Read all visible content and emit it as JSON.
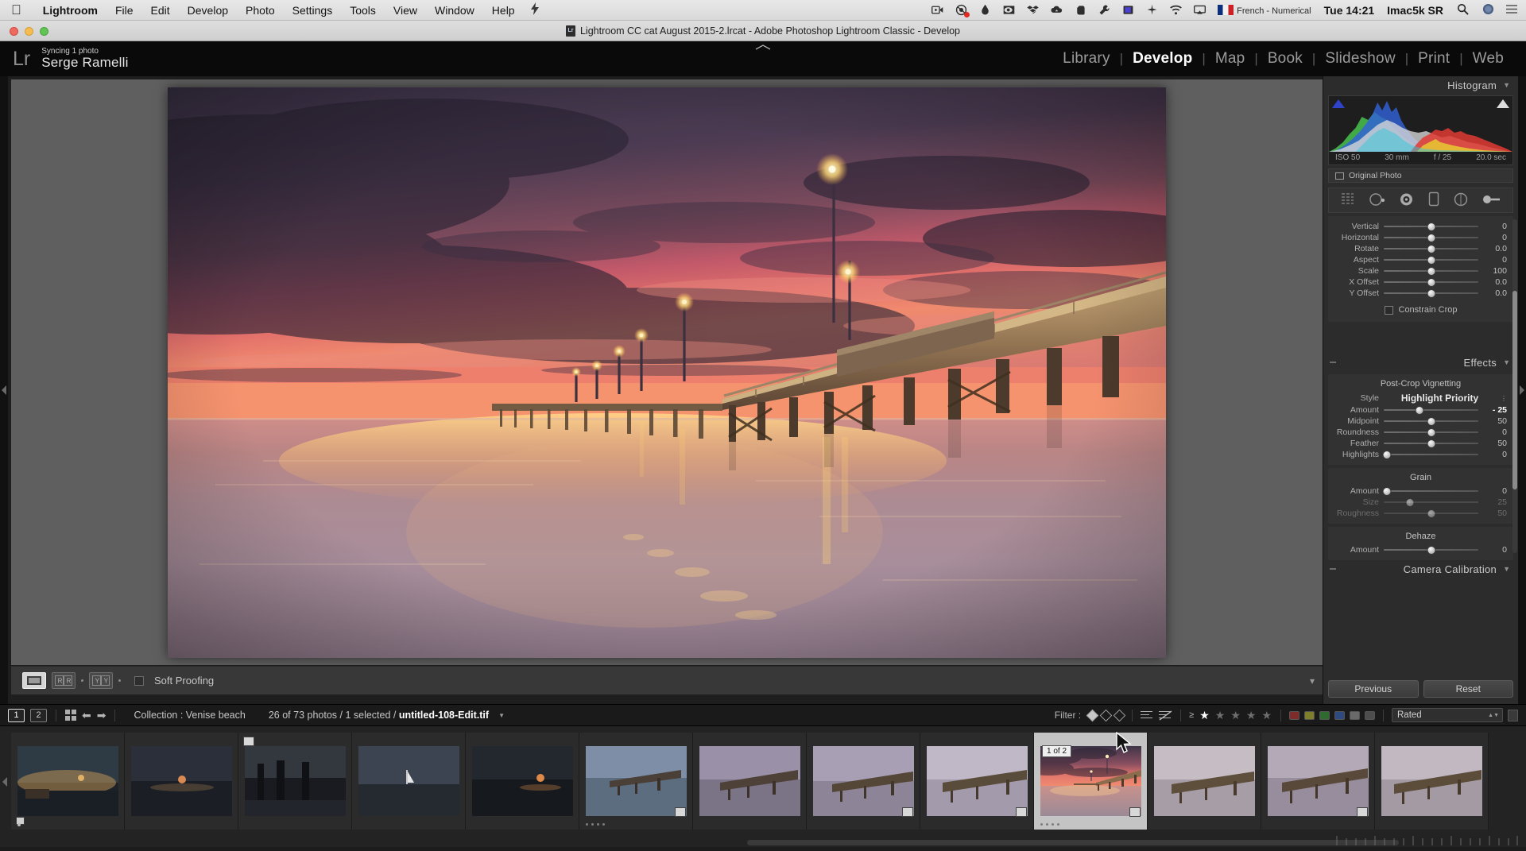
{
  "macmenu": {
    "apple_icon": "apple-logo-icon",
    "items": [
      {
        "label": "Lightroom",
        "bold": true
      },
      {
        "label": "File",
        "bold": false
      },
      {
        "label": "Edit",
        "bold": false
      },
      {
        "label": "Develop",
        "bold": false
      },
      {
        "label": "Photo",
        "bold": false
      },
      {
        "label": "Settings",
        "bold": false
      },
      {
        "label": "Tools",
        "bold": false
      },
      {
        "label": "View",
        "bold": false
      },
      {
        "label": "Window",
        "bold": false
      },
      {
        "label": "Help",
        "bold": false
      }
    ],
    "status_icons": [
      "screen-recording-icon",
      "camera-icon",
      "droplet-icon",
      "eye-icon",
      "dropbox-icon",
      "cloud-icon",
      "evernote-icon",
      "wrench-icon",
      "display-icon",
      "compass-icon",
      "wifi-icon",
      "airplay-icon"
    ],
    "language": "French - Numerical",
    "clock": "Tue 14:21",
    "user": "Imac5k SR",
    "search_icon": "search-icon",
    "siri_icon": "siri-icon",
    "control_center_icon": "control-center-icon"
  },
  "window": {
    "title": "Lightroom CC cat August 2015-2.lrcat - Adobe Photoshop Lightroom Classic - Develop",
    "doc_icon": "lightroom-catalog-icon",
    "close_label": "close",
    "minimize_label": "minimize",
    "zoom_label": "zoom"
  },
  "topbar": {
    "logo": "Lr",
    "sync_status": "Syncing 1 photo",
    "identity_name": "Serge Ramelli",
    "modules": [
      {
        "label": "Library",
        "active": false
      },
      {
        "label": "Develop",
        "active": true
      },
      {
        "label": "Map",
        "active": false
      },
      {
        "label": "Book",
        "active": false
      },
      {
        "label": "Slideshow",
        "active": false
      },
      {
        "label": "Print",
        "active": false
      },
      {
        "label": "Web",
        "active": false
      }
    ]
  },
  "toolbar": {
    "view_loupe": "loupe-view",
    "view_compare": "compare-view",
    "view_before_after": "before-after-view",
    "softproof_label": "Soft Proofing"
  },
  "right_panel": {
    "histogram": {
      "title": "Histogram",
      "iso": "ISO 50",
      "focal": "30 mm",
      "aperture": "f / 25",
      "shutter": "20.0 sec",
      "original_photo": "Original Photo"
    },
    "tool_strip": [
      "crop-tool-icon",
      "spot-removal-icon",
      "red-eye-icon",
      "graduated-filter-icon",
      "radial-filter-icon",
      "adjustment-brush-icon"
    ],
    "transform": {
      "sliders": [
        {
          "label": "Vertical",
          "value": "0",
          "pos": 50
        },
        {
          "label": "Horizontal",
          "value": "0",
          "pos": 50
        },
        {
          "label": "Rotate",
          "value": "0.0",
          "pos": 50
        },
        {
          "label": "Aspect",
          "value": "0",
          "pos": 50
        },
        {
          "label": "Scale",
          "value": "100",
          "pos": 50
        },
        {
          "label": "X Offset",
          "value": "0.0",
          "pos": 50
        },
        {
          "label": "Y Offset",
          "value": "0.0",
          "pos": 50
        }
      ],
      "constrain_crop": "Constrain Crop"
    },
    "effects": {
      "title": "Effects",
      "section_title": "Post-Crop Vignetting",
      "style_label": "Style",
      "style_value": "Highlight Priority",
      "sliders": [
        {
          "label": "Amount",
          "value": "- 25",
          "pos": 38,
          "dim": false
        },
        {
          "label": "Midpoint",
          "value": "50",
          "pos": 50,
          "dim": false
        },
        {
          "label": "Roundness",
          "value": "0",
          "pos": 50,
          "dim": false
        },
        {
          "label": "Feather",
          "value": "50",
          "pos": 50,
          "dim": false
        },
        {
          "label": "Highlights",
          "value": "0",
          "pos": 3,
          "dim": false
        }
      ]
    },
    "grain": {
      "section_title": "Grain",
      "sliders": [
        {
          "label": "Amount",
          "value": "0",
          "pos": 3,
          "dim": false
        },
        {
          "label": "Size",
          "value": "25",
          "pos": 28,
          "dim": true
        },
        {
          "label": "Roughness",
          "value": "50",
          "pos": 50,
          "dim": true
        }
      ]
    },
    "dehaze": {
      "section_title": "Dehaze",
      "sliders": [
        {
          "label": "Amount",
          "value": "0",
          "pos": 50,
          "dim": false
        }
      ]
    },
    "camera_calibration": {
      "title": "Camera Calibration"
    },
    "buttons": {
      "previous": "Previous",
      "reset": "Reset"
    }
  },
  "filmstrip_bar": {
    "display_1": "1",
    "display_2": "2",
    "grid_icon": "grid-view-icon",
    "back_icon": "navigate-back-icon",
    "forward_icon": "navigate-forward-icon",
    "collection": "Collection : Venise beach",
    "count_prefix": "26 of 73 photos / 1 selected / ",
    "filename": "untitled-108-Edit.tif",
    "filter_label": "Filter :",
    "flag_icons": [
      "flag-picked-icon",
      "flag-unflagged-icon",
      "flag-rejected-icon"
    ],
    "attr_icons": [
      "attribute-filter-icon",
      "attribute-off-icon"
    ],
    "rating_operator": "≥",
    "stars": [
      true,
      false,
      false,
      false,
      false
    ],
    "color_labels": [
      "#a03030",
      "#a0a030",
      "#3c8c3c",
      "#3a5fa0",
      "#8a8a8a",
      "#6a6a6a"
    ],
    "preset_value": "Rated"
  },
  "filmstrip": {
    "selected_badge": "1 of 2",
    "selected_index": 9,
    "thumbs": [
      {
        "id": "t1",
        "badge": "",
        "edited": true
      },
      {
        "id": "t2",
        "badge": "",
        "edited": false
      },
      {
        "id": "t3",
        "badge": "",
        "edited": false
      },
      {
        "id": "t4",
        "badge": "",
        "edited": false
      },
      {
        "id": "t5",
        "badge": "",
        "edited": false
      },
      {
        "id": "t6",
        "badge": "",
        "edited": true
      },
      {
        "id": "t7",
        "badge": "",
        "edited": true
      },
      {
        "id": "t8",
        "badge": "",
        "edited": false
      },
      {
        "id": "t9",
        "badge": "",
        "edited": true
      },
      {
        "id": "t10",
        "badge": "1 of 2",
        "edited": true
      },
      {
        "id": "t11",
        "badge": "",
        "edited": false
      },
      {
        "id": "t12",
        "badge": "",
        "edited": true
      },
      {
        "id": "t13",
        "badge": "",
        "edited": false
      }
    ]
  },
  "colors": {
    "panel_bg": "#2c2c2c",
    "canvas_bg": "#5f5f5f",
    "topbar_bg": "#0a0a0a",
    "accent_text": "#ffffff"
  }
}
